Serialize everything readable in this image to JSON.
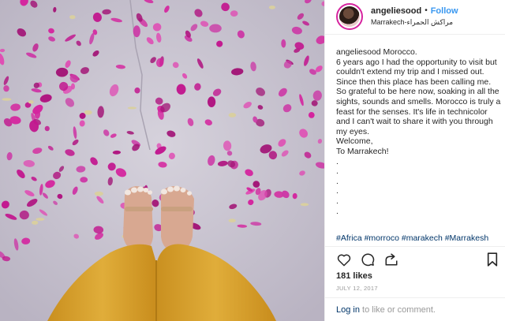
{
  "header": {
    "username": "angeliesood",
    "separator": "•",
    "follow_label": "Follow",
    "location": "Marrakech-مراكش الحمراء"
  },
  "caption": {
    "text": "angeliesood Morocco.\n6 years ago I had the opportunity to visit but couldn't extend my trip and I missed out. Since then this place has been calling me. So grateful to be here now, soaking in all the sights, sounds and smells. Morocco is truly a feast for the senses. It's life in technicolor and I can't wait to share it with you through my eyes.\nWelcome,\nTo Marrakech!\n.\n.\n.\n.\n.\n.",
    "hashtags": "#Africa #morroco #marakech #Marrakesh"
  },
  "actions": {
    "like_icon": "heart-icon",
    "comment_icon": "comment-icon",
    "share_icon": "share-icon",
    "save_icon": "bookmark-icon"
  },
  "likes": "181 likes",
  "date": "JULY 12, 2017",
  "login": {
    "link_label": "Log in",
    "suffix": " to like or comment."
  },
  "colors": {
    "link_blue": "#3897f0",
    "hashtag": "#003569",
    "petal": "#c2188f",
    "floor": "#c9c6cf",
    "pants": "#d9a12b"
  }
}
